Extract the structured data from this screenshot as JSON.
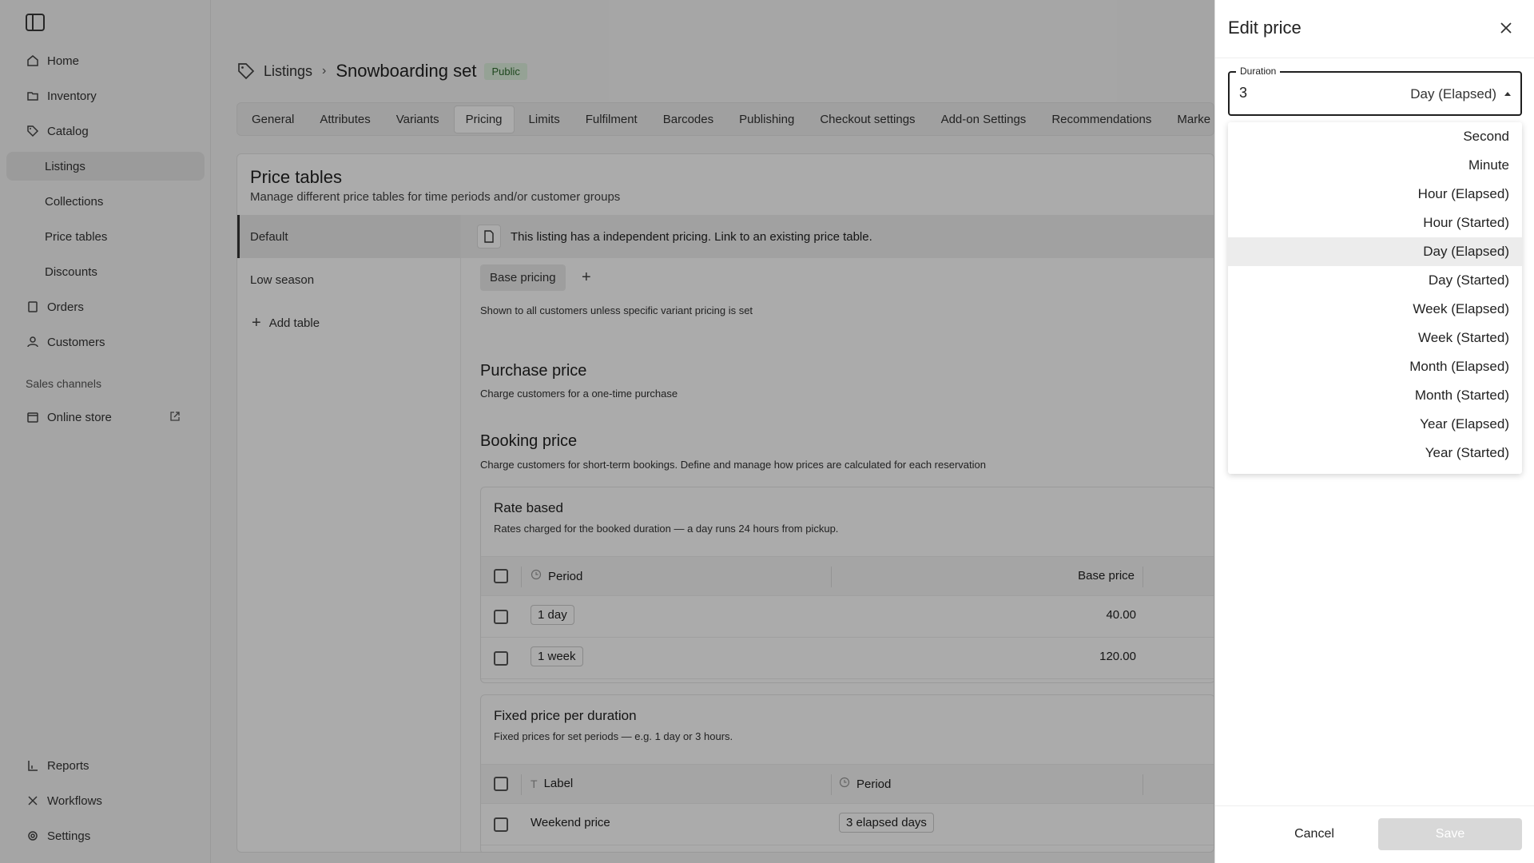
{
  "sidebar": {
    "items": [
      {
        "label": "Home",
        "icon": "home-icon"
      },
      {
        "label": "Inventory",
        "icon": "folder-icon"
      },
      {
        "label": "Catalog",
        "icon": "tag-icon"
      },
      {
        "label": "Listings"
      },
      {
        "label": "Collections"
      },
      {
        "label": "Price tables"
      },
      {
        "label": "Discounts"
      },
      {
        "label": "Orders",
        "icon": "orders-icon"
      },
      {
        "label": "Customers",
        "icon": "user-icon"
      }
    ],
    "section": "Sales channels",
    "online_store": "Online store",
    "bottom": [
      {
        "label": "Reports",
        "icon": "chart-icon"
      },
      {
        "label": "Workflows",
        "icon": "workflow-icon"
      },
      {
        "label": "Settings",
        "icon": "gear-icon"
      }
    ]
  },
  "header": {
    "breadcrumb": "Listings",
    "title": "Snowboarding set",
    "badge": "Public"
  },
  "tabs": [
    "General",
    "Attributes",
    "Variants",
    "Pricing",
    "Limits",
    "Fulfilment",
    "Barcodes",
    "Publishing",
    "Checkout settings",
    "Add-on Settings",
    "Recommendations",
    "Marke"
  ],
  "price_tables": {
    "title": "Price tables",
    "subtitle": "Manage different price tables for time periods and/or customer groups",
    "tables": [
      "Default",
      "Low season"
    ],
    "add_table": "Add table",
    "info": "This listing has a independent pricing. Link to an existing price table.",
    "base_pricing": "Base pricing",
    "shown_to": "Shown to all customers unless specific variant pricing is set"
  },
  "purchase": {
    "title": "Purchase price",
    "subtitle": "Charge customers for a one-time purchase"
  },
  "booking": {
    "title": "Booking price",
    "subtitle": "Charge customers for short-term bookings. Define and manage how prices are calculated for each reservation"
  },
  "rate_based": {
    "title": "Rate based",
    "subtitle": "Rates charged for the booked duration — a day runs 24 hours from pickup.",
    "col_period": "Period",
    "col_base_price": "Base price",
    "rows": [
      {
        "period": "1 day",
        "price": "40.00"
      },
      {
        "period": "1 week",
        "price": "120.00"
      }
    ]
  },
  "fixed_price": {
    "title": "Fixed price per duration",
    "subtitle": "Fixed prices for set periods — e.g. 1 day or 3 hours.",
    "col_label": "Label",
    "col_period": "Period",
    "rows": [
      {
        "label": "Weekend price",
        "period": "3 elapsed days"
      }
    ]
  },
  "drawer": {
    "title": "Edit price",
    "field_label": "Duration",
    "duration_value": "3",
    "unit_selected": "Day (Elapsed)",
    "options": [
      "Second",
      "Minute",
      "Hour (Elapsed)",
      "Hour (Started)",
      "Day (Elapsed)",
      "Day (Started)",
      "Week (Elapsed)",
      "Week (Started)",
      "Month (Elapsed)",
      "Month (Started)",
      "Year (Elapsed)",
      "Year (Started)"
    ],
    "cancel": "Cancel",
    "save": "Save"
  }
}
